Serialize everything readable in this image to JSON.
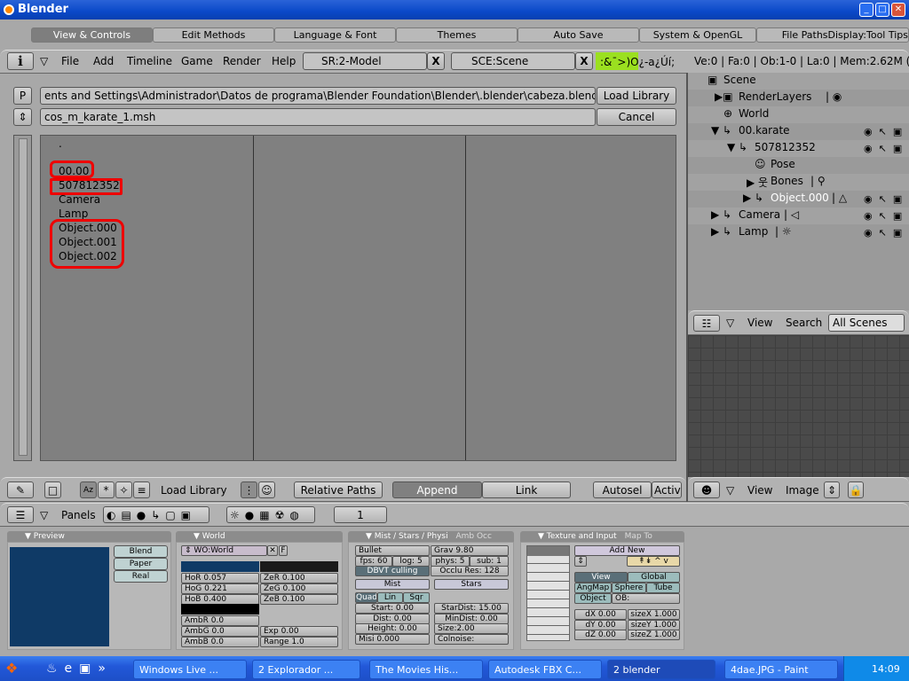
{
  "window": {
    "title": "Blender",
    "min": "_",
    "max": "□",
    "close": "✕"
  },
  "prefs_tabs": [
    "View & Controls",
    "Edit Methods",
    "Language & Font",
    "Themes",
    "Auto Save",
    "System & OpenGL",
    "File PathsDisplay:Tool Tips"
  ],
  "header": {
    "menus": [
      "File",
      "Add",
      "Timeline",
      "Game",
      "Render",
      "Help"
    ],
    "screen": "SR:2-Model",
    "scene": "SCE:Scene",
    "info": ":&¯>)O¿-a¿Úí;",
    "stats": "Ve:0 | Fa:0 | Ob:1-0 | La:0  | Mem:2.62M ("
  },
  "filebrowser": {
    "p_button": "P",
    "path": "ents and Settings\\Administrador\\Datos de programa\\Blender Foundation\\Blender\\.blender\\cabeza.blend\\Object\\",
    "file": "cos_m_karate_1.msh",
    "load_button": "Load Library",
    "cancel_button": "Cancel",
    "items": [
      ".",
      "00.00",
      "507812352",
      "Camera",
      "Lamp",
      "Object.000",
      "Object.001",
      "Object.002"
    ],
    "footer": {
      "title": "Load Library",
      "relative_paths": "Relative Paths",
      "append": "Append",
      "link": "Link",
      "autosel": "Autosel",
      "active": "Activ"
    }
  },
  "outliner": {
    "items": [
      "Scene",
      "RenderLayers",
      "World",
      "00.karate",
      "507812352",
      "Pose",
      "Bones",
      "Object.000",
      "Camera",
      "Lamp"
    ],
    "view": "View",
    "search": "Search",
    "scope": "All Scenes"
  },
  "image_header": {
    "view": "View",
    "image": "Image"
  },
  "buttons": {
    "panels_label": "Panels",
    "frame": "1",
    "preview": {
      "title": "Preview",
      "blend": "Blend",
      "paper": "Paper",
      "real": "Real",
      "color": "#0f3a66"
    },
    "world": {
      "title": "World",
      "name": "WO:World",
      "x": "✕",
      "f": "F",
      "hor": "HoR 0.057",
      "hog": "HoG 0.221",
      "hob": "HoB 0.400",
      "zer": "ZeR 0.100",
      "zeg": "ZeG 0.100",
      "zeb": "ZeB 0.100",
      "ambr": "AmbR 0.0",
      "ambg": "AmbG 0.0",
      "ambb": "AmbB 0.0",
      "exp": "Exp 0.00",
      "range": "Range 1.0",
      "horizon_color": "#0f3a66",
      "zenith_color": "#1a1a1a"
    },
    "mist": {
      "tab1": "Mist / Stars / Physi",
      "tab2": "Amb Occ",
      "engine": "Bullet",
      "grav": "Grav 9.80",
      "fps": "fps: 60",
      "log": "log: 5",
      "phys": "phys: 5",
      "sub": "sub: 1",
      "dbvt": "DBVT culling",
      "occlu": "Occlu Res: 128",
      "mist": "Mist",
      "stars": "Stars",
      "quad": "Quad",
      "lin": "Lin",
      "sqr": "Sqr",
      "start": "Start: 0.00",
      "dist": "Dist: 0.00",
      "height": "Height: 0.00",
      "misi": "Misi 0.000",
      "stardist": "StarDist: 15.00",
      "mindist": "MinDist: 0.00",
      "size": "Size:2.00",
      "colnoise": "Colnoise:"
    },
    "texture": {
      "tab1": "Texture and Input",
      "tab2": "Map To",
      "add_new": "Add New",
      "view": "View",
      "global": "Global",
      "angmap": "AngMap",
      "sphere": "Sphere",
      "tube": "Tube",
      "object": "Object",
      "ob": "OB:",
      "dx": "dX 0.00",
      "dy": "dY 0.00",
      "dz": "dZ 0.00",
      "sizex": "sizeX 1.000",
      "sizey": "sizeY 1.000",
      "sizez": "sizeZ 1.000"
    }
  },
  "taskbar": {
    "items": [
      "Windows Live ...",
      "2 Explorador ...",
      "The Movies His...",
      "Autodesk FBX C...",
      "2 blender",
      "4dae.JPG - Paint"
    ],
    "clock": "14:09"
  }
}
